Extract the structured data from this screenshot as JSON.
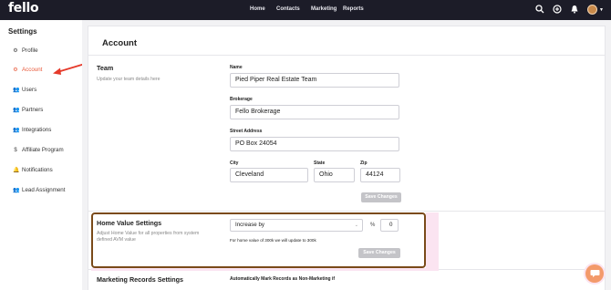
{
  "app": {
    "logo": "fello"
  },
  "topnav": {
    "items": [
      "Home",
      "Contacts",
      "Marketing",
      "Reports"
    ],
    "icons": [
      "search-icon",
      "add-circle-icon",
      "bell-icon",
      "avatar",
      "chevron-down-icon"
    ]
  },
  "sidebar": {
    "title": "Settings",
    "items": [
      {
        "label": "Profile",
        "icon": "gear-icon",
        "active": false
      },
      {
        "label": "Account",
        "icon": "gear-icon",
        "active": true
      },
      {
        "label": "Users",
        "icon": "users-icon",
        "active": false
      },
      {
        "label": "Partners",
        "icon": "users-icon",
        "active": false
      },
      {
        "label": "Integrations",
        "icon": "users-icon",
        "active": false
      },
      {
        "label": "Affiliate Program",
        "icon": "dollar-icon",
        "active": false
      },
      {
        "label": "Notifications",
        "icon": "bell-icon",
        "active": false
      },
      {
        "label": "Lead Assignment",
        "icon": "users-icon",
        "active": false
      }
    ]
  },
  "account": {
    "title": "Account",
    "team": {
      "title": "Team",
      "description": "Update your team details here",
      "fields": {
        "name": {
          "label": "Name",
          "value": "Pied Piper Real Estate Team"
        },
        "brokerage": {
          "label": "Brokerage",
          "value": "Fello Brokerage"
        },
        "street": {
          "label": "Street Address",
          "value": "PO Box 24054"
        },
        "city": {
          "label": "City",
          "value": "Cleveland"
        },
        "state": {
          "label": "State",
          "value": "Ohio"
        },
        "zip": {
          "label": "Zip",
          "value": "44124"
        }
      },
      "save_label": "Save Changes"
    },
    "home_value": {
      "title": "Home Value Settings",
      "description": "Adjust Home Value for all properties from system defined AVM value",
      "adjust_select": "Increase by",
      "unit": "%",
      "amount": "0",
      "note": "For home value of 300k we will update to 300k",
      "save_label": "Save Changes"
    },
    "marketing_records": {
      "title": "Marketing Records Settings",
      "auto_mark_label": "Automatically Mark Records as Non-Marketing if"
    }
  },
  "colors": {
    "accent": "#e8593a",
    "topbar": "#1c1c28",
    "highlight_border": "#7a4a19"
  }
}
